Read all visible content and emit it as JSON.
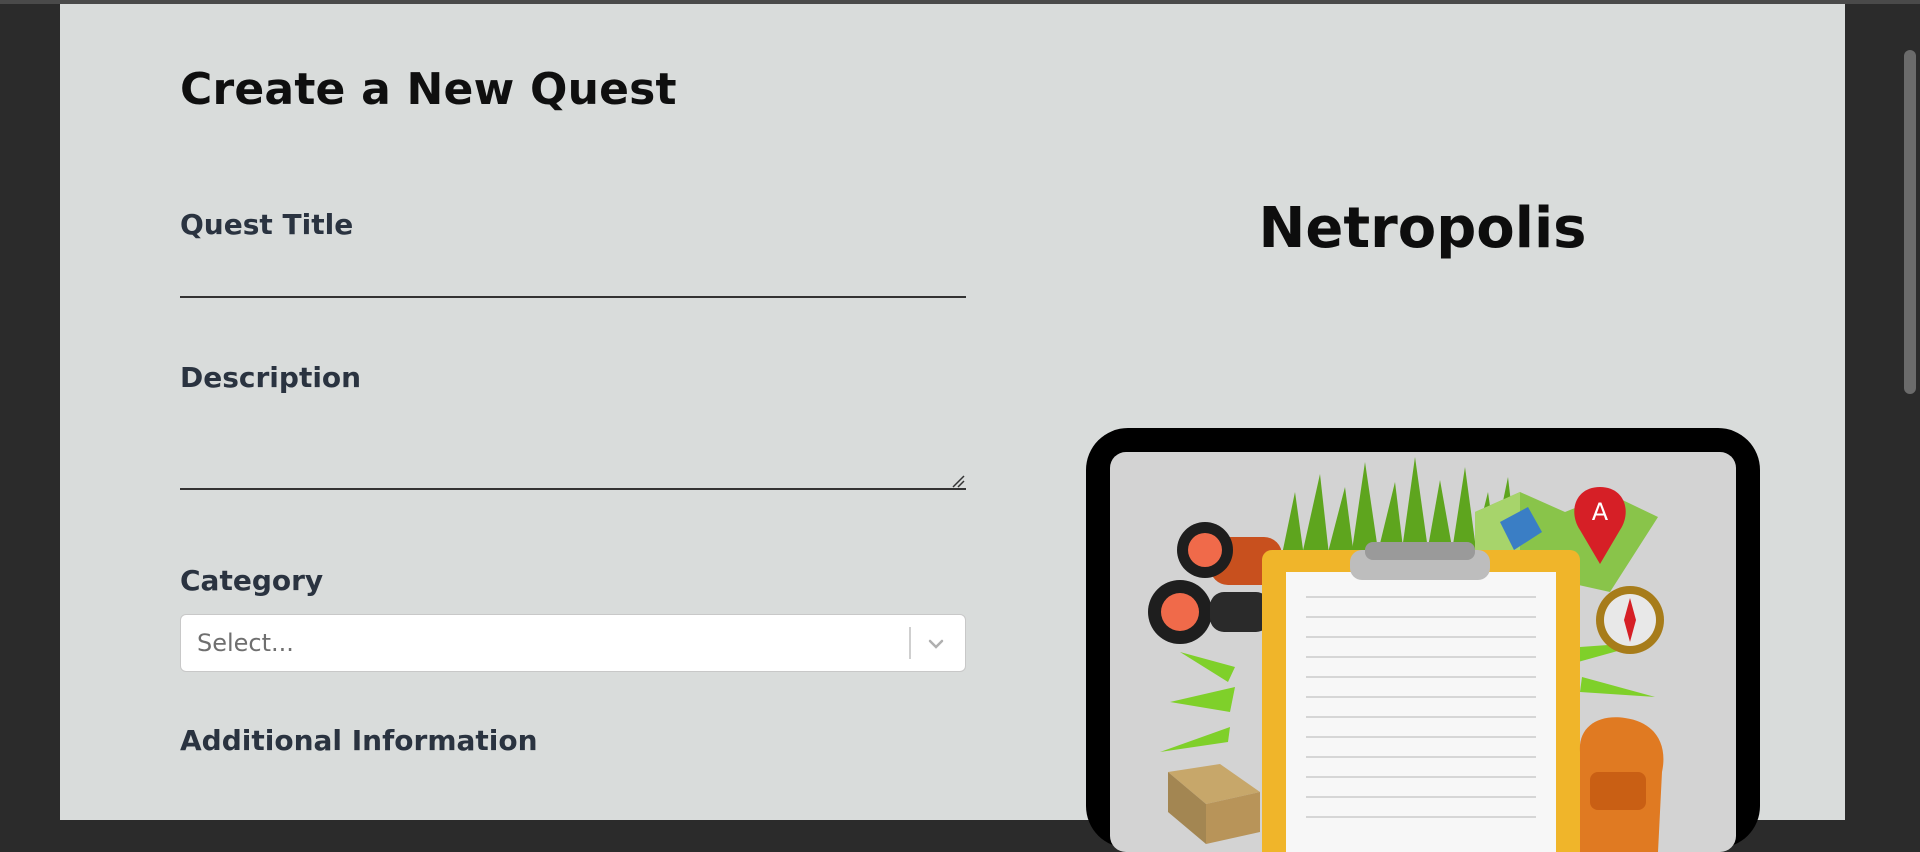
{
  "form": {
    "title": "Create a New Quest",
    "quest_title_label": "Quest Title",
    "quest_title_value": "",
    "description_label": "Description",
    "description_value": "",
    "category_label": "Category",
    "category_placeholder": "Select...",
    "additional_info_label": "Additional Information"
  },
  "preview": {
    "brand": "Netropolis",
    "image_icon": "quest-clipboard-illustration"
  },
  "colors": {
    "page_bg": "#d9dcdb",
    "outer_bg": "#2b2b2b",
    "clipboard": "#f0b52a",
    "pin": "#d61f26"
  }
}
